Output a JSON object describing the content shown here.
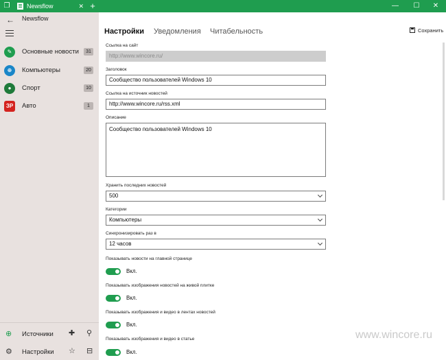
{
  "window": {
    "tab_title": "Newsflow",
    "tab_close": "✕",
    "new_tab": "+",
    "minimize": "—",
    "maximize": "☐",
    "close": "✕"
  },
  "sidebar": {
    "back": "←",
    "app_name": "Newsflow",
    "items": [
      {
        "label": "Основные новости",
        "count": "31",
        "icon": "news-icon",
        "color": "#1f9d4f"
      },
      {
        "label": "Компьютеры",
        "count": "20",
        "icon": "globe-icon",
        "color": "#1a86c8"
      },
      {
        "label": "Спорт",
        "count": "10",
        "icon": "soccer-ball-icon",
        "color": "#1f7a3a"
      },
      {
        "label": "Авто",
        "count": "1",
        "icon": "zr-logo-icon",
        "color": "#d4231f",
        "icon_text": "ЗР"
      }
    ],
    "bottom": [
      {
        "label": "Источники"
      },
      {
        "label": "Настройки"
      }
    ]
  },
  "main": {
    "tabs": [
      "Настройки",
      "Уведомления",
      "Читабельность"
    ],
    "save_label": "Сохранить",
    "fields": {
      "site_label": "Ссылка на сайт",
      "site_value": "http://www.wincore.ru/",
      "title_label": "Заголовок",
      "title_value": "Сообщество пользователей Windows 10",
      "source_label": "Ссылка на источник новостей",
      "source_value": "http://www.wincore.ru/rss.xml",
      "desc_label": "Описание",
      "desc_value": "Сообщество пользователей Windows 10",
      "keep_label": "Хранить последних новостей",
      "keep_value": "500",
      "category_label": "Категории",
      "category_value": "Компьютеры",
      "sync_label": "Синхронизировать раз в",
      "sync_value": "12 часов"
    },
    "toggles": [
      {
        "label": "Показывать новости на главной странице",
        "state": "Вкл."
      },
      {
        "label": "Показывать изображения новостей на живой плитке",
        "state": "Вкл."
      },
      {
        "label": "Показывать изображения и видео в лентах новостей",
        "state": "Вкл."
      },
      {
        "label": "Показывать изображения и видео в статье",
        "state": "Вкл."
      }
    ],
    "watermark": "www.wincore.ru",
    "accent_color": "#1f9d4f"
  }
}
